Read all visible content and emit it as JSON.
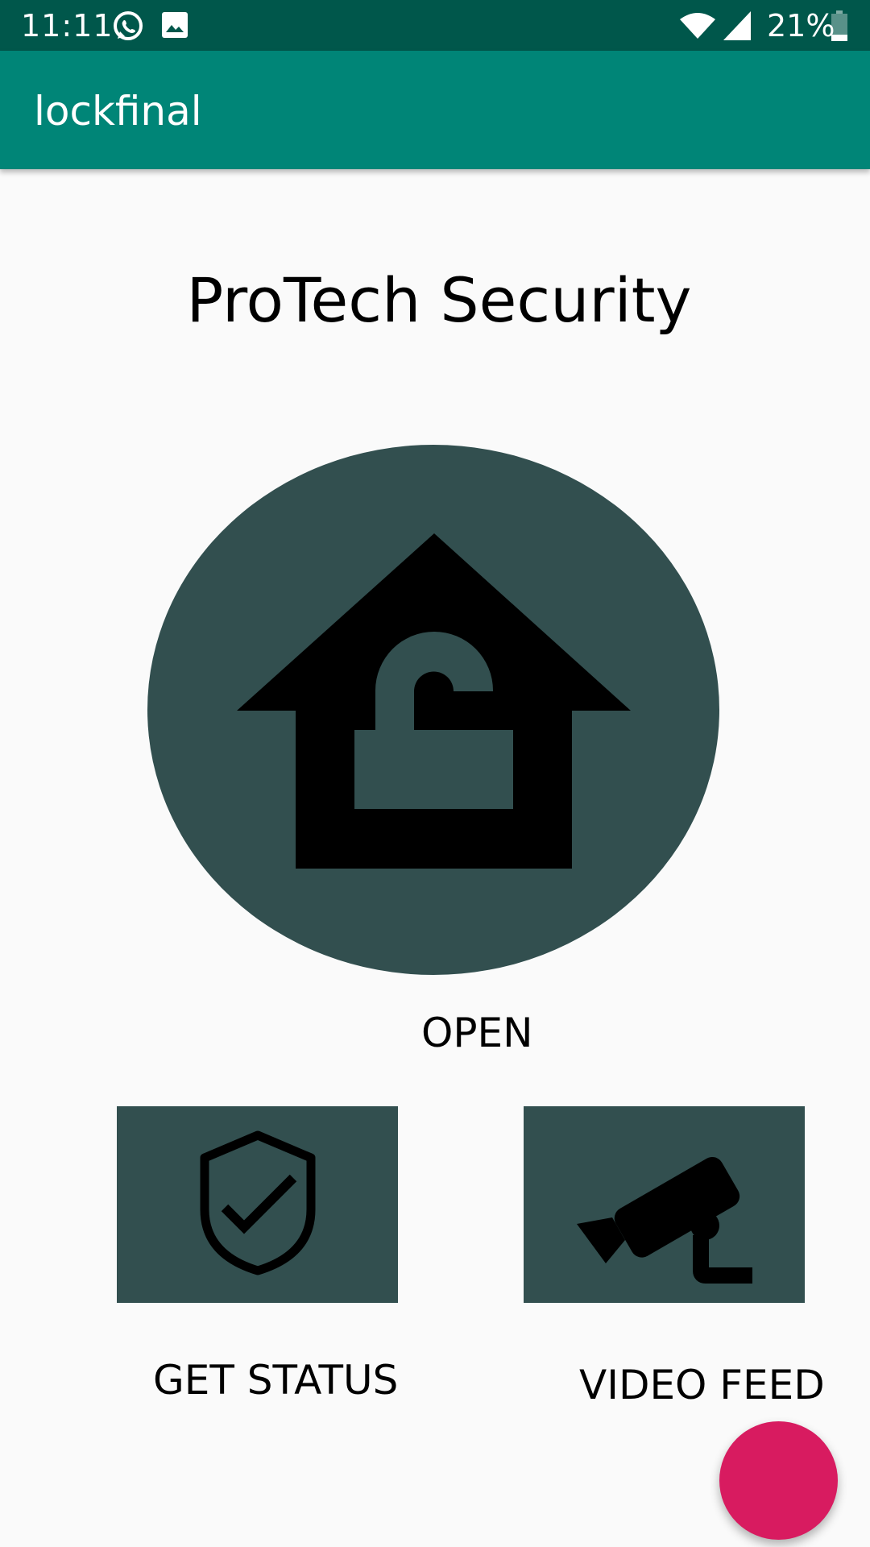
{
  "status_bar": {
    "time": "11:11",
    "battery_percent": "21%",
    "icons": [
      "whatsapp-icon",
      "image-icon",
      "wifi-icon",
      "cell-signal-icon",
      "battery-icon"
    ]
  },
  "app_bar": {
    "title": "lockfinal"
  },
  "main": {
    "heading": "ProTech Security",
    "open_label": "OPEN",
    "status_label": "GET STATUS",
    "video_label": "VIDEO FEED"
  },
  "colors": {
    "status_bar": "#00574b",
    "app_bar": "#008577",
    "button_bg": "#324f4f",
    "fab": "#d81b60",
    "background": "#fafafa"
  }
}
